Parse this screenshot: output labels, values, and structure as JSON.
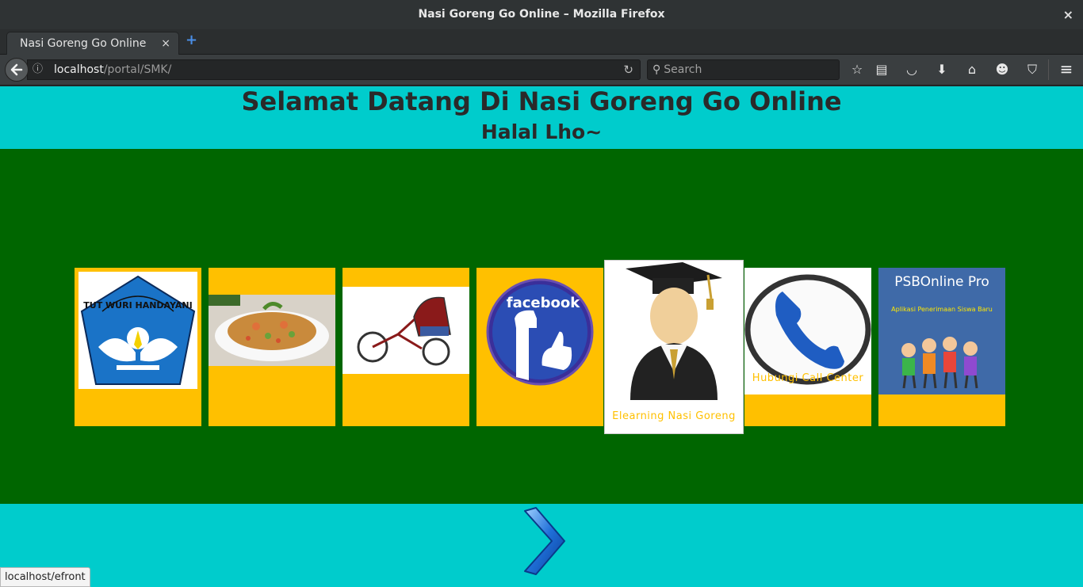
{
  "window": {
    "title": "Nasi Goreng Go Online – Mozilla Firefox",
    "close_label": "×"
  },
  "tab": {
    "title": "Nasi Goreng Go Online",
    "close_label": "×",
    "new_tab_label": "+"
  },
  "navbar": {
    "url_host": "localhost",
    "url_path": "/portal/SMK/",
    "search_placeholder": "Search"
  },
  "page": {
    "title": "Selamat Datang Di Nasi Goreng Go Online",
    "subtitle": "Halal Lho~",
    "tiles": [
      {
        "name": "tut-wuri-handayani-logo",
        "caption": ""
      },
      {
        "name": "nasi-goreng-photo",
        "caption": ""
      },
      {
        "name": "becak-photo",
        "caption": ""
      },
      {
        "name": "facebook-logo",
        "caption": "",
        "logo_text": "facebook"
      },
      {
        "name": "elearning-graduate",
        "caption": "Elearning Nasi Goreng"
      },
      {
        "name": "call-center-phone",
        "caption": "Hubungi Call Center"
      },
      {
        "name": "psbonline-pro",
        "caption": "",
        "logo_title": "PSBOnline Pro",
        "logo_subtitle": "Aplikasi Penerimaan Siswa Baru"
      }
    ]
  },
  "statusbar": {
    "text": "localhost/efront"
  },
  "colors": {
    "page_bg": "#00cccc",
    "stage_bg": "#006600",
    "tile": "#ffc000"
  }
}
